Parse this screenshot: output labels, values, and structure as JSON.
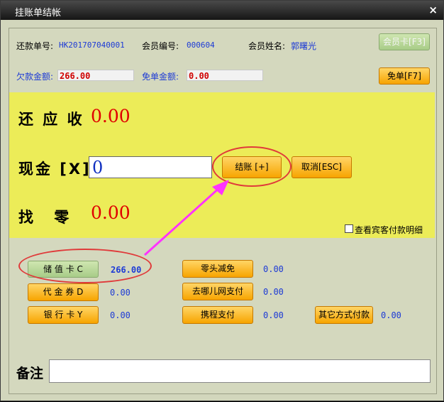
{
  "window": {
    "title": "挂账单结帐",
    "close": "×"
  },
  "header": {
    "repay_no_label": "还款单号:",
    "repay_no": "HK201707040001",
    "member_no_label": "会员编号:",
    "member_no": "000604",
    "member_name_label": "会员姓名:",
    "member_name": "郭曙光",
    "member_card_btn": "会员卡[F3]",
    "owed_label": "欠款金额:",
    "owed": "266.00",
    "waived_label": "免单金额:",
    "waived": "0.00",
    "waive_btn": "免单[F7]"
  },
  "summary": {
    "due_label": "还 应 收",
    "due": "0.00",
    "cash_label": "现金 [X]",
    "cash_value": "0",
    "checkout_btn": "结账 [+]",
    "cancel_btn": "取消[ESC]",
    "change_label": "找    零",
    "change": "0.00",
    "detail_label": "查看宾客付款明细"
  },
  "payments": [
    {
      "label": "储 值 卡 C",
      "value": "266.00"
    },
    {
      "label": "代 金 券 D",
      "value": "0.00"
    },
    {
      "label": "银 行 卡 Y",
      "value": "0.00"
    },
    {
      "label": "零头减免",
      "value": "0.00"
    },
    {
      "label": "去哪儿网支付",
      "value": "0.00"
    },
    {
      "label": "携程支付",
      "value": "0.00"
    },
    {
      "label": "其它方式付款",
      "value": "0.00"
    }
  ],
  "remark": {
    "label": "备注"
  },
  "colors": {
    "accent_orange": "#f7a400",
    "yellow_panel": "#ecec58",
    "value_red": "#e00000",
    "annotation": "#e03a3a",
    "arrow": "#ff33ff"
  }
}
